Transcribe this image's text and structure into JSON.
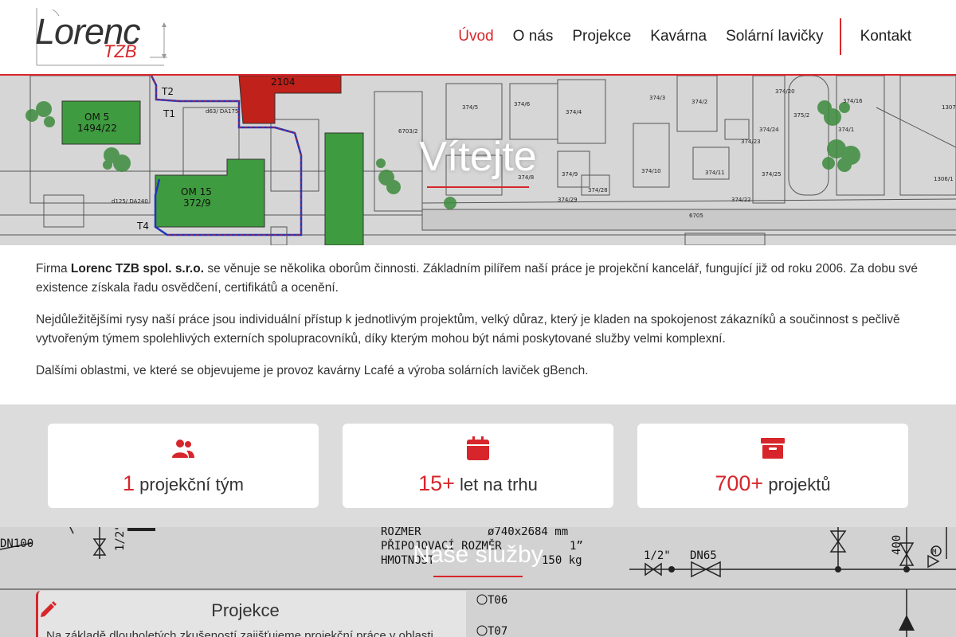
{
  "header": {
    "logo_main": "Lorenc",
    "logo_sub": "TZB",
    "nav": [
      {
        "label": "Úvod",
        "active": true
      },
      {
        "label": "O nás"
      },
      {
        "label": "Projekce"
      },
      {
        "label": "Kavárna"
      },
      {
        "label": "Solární lavičky"
      },
      {
        "label": "Kontakt"
      }
    ]
  },
  "hero": {
    "title": "Vítejte",
    "map_labels": [
      "OM 5",
      "1494/22",
      "OM 15",
      "372/9",
      "2104",
      "T1",
      "T2",
      "T4",
      "6705",
      "374/5",
      "374/6",
      "374/4",
      "374/3",
      "374/2",
      "374/1",
      "374/16",
      "374/20",
      "375/2",
      "374/9",
      "374/8",
      "374/10",
      "374/11",
      "374/28",
      "374/29",
      "374/22",
      "374/24",
      "374/23",
      "374/25",
      "1306/1",
      "1307",
      "d63/ DA175",
      "d125/ DA240",
      "6703/2"
    ]
  },
  "intro": {
    "p1_prefix": "Firma ",
    "p1_company": "Lorenc TZB spol. s.r.o.",
    "p1_rest": " se věnuje se několika oborům činnosti. Základním pilířem naší práce je projekční kancelář, fungující již od roku 2006. Za dobu své existence získala řadu osvědčení, certifikátů a ocenění.",
    "p2": "Nejdůležitějšími rysy naší práce jsou individuální přístup k jednotlivým projektům, velký důraz, který je kladen na spokojenost zákazníků a součinnost s pečlivě vytvořeným týmem spolehlivých externích spolupracovníků, díky kterým mohou být námi poskytované služby velmi komplexní.",
    "p3": "Dalšími oblastmi, ve které se objevujeme je provoz kavárny Lcafé a výroba solárních laviček gBench."
  },
  "stats": [
    {
      "icon": "users-icon",
      "number": "1",
      "label": "projekční tým"
    },
    {
      "icon": "calendar-icon",
      "number": "15+",
      "label": "let na trhu"
    },
    {
      "icon": "archive-icon",
      "number": "700+",
      "label": "projektů"
    }
  ],
  "services": {
    "title": "Naše služby",
    "schematic_labels": [
      "ROZMER",
      "PŘIPOJOVACÍ ROZMĚR",
      "HMOTNOST",
      "ø740x2684 mm",
      "1”",
      "150 kg",
      "DN100",
      "1/2\"",
      "DN65",
      "400",
      "M",
      "T06",
      "T07"
    ],
    "card": {
      "title": "Projekce",
      "text": "Na základě dlouholetých zkušeností zajišťujeme projekční práce v oblasti"
    }
  },
  "colors": {
    "accent": "#d7262b",
    "map_green": "#3f9b3f",
    "map_red": "#c0211a"
  }
}
